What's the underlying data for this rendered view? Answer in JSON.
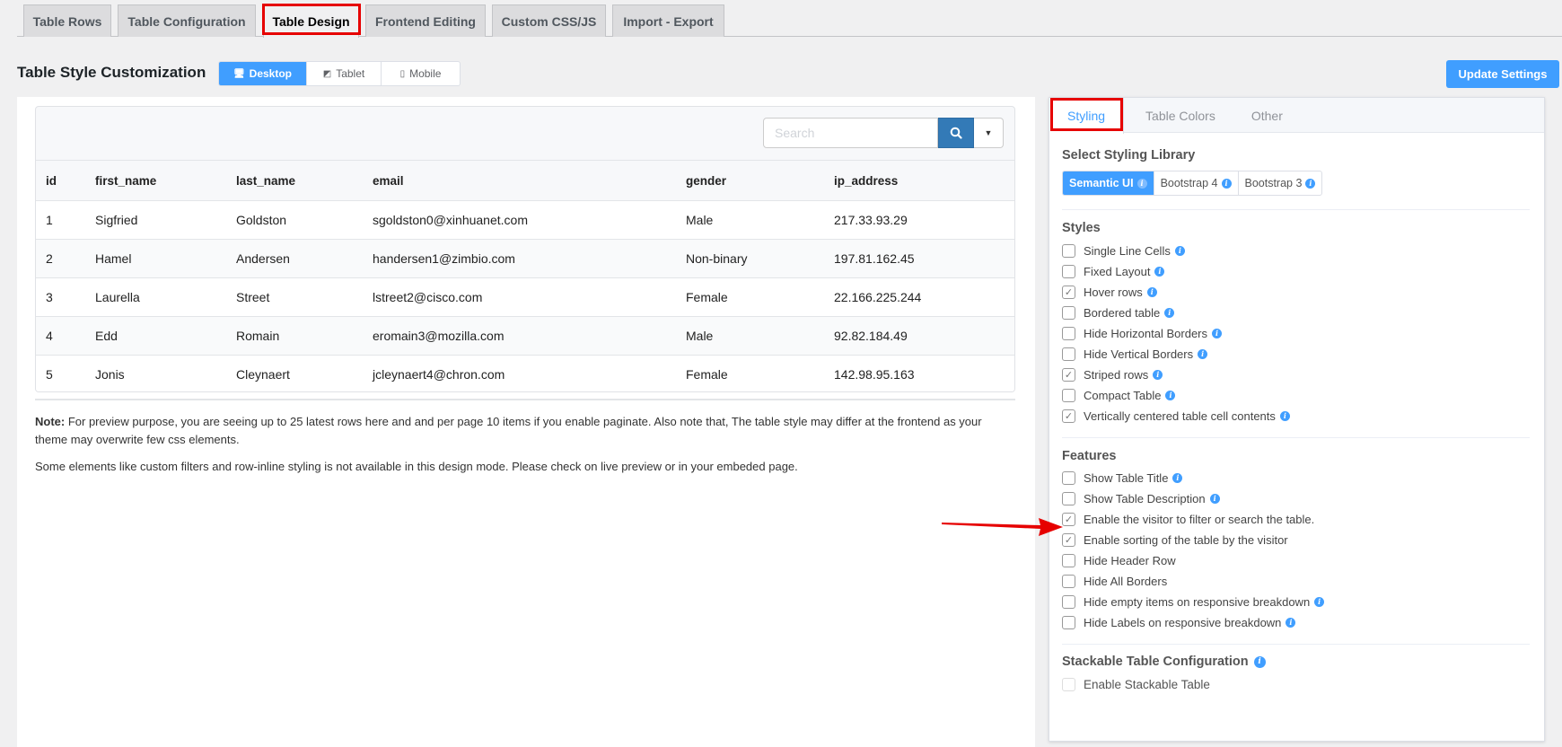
{
  "top_tabs": [
    {
      "label": "Table Rows",
      "active": false
    },
    {
      "label": "Table Configuration",
      "active": false
    },
    {
      "label": "Table Design",
      "active": true
    },
    {
      "label": "Frontend Editing",
      "active": false
    },
    {
      "label": "Custom CSS/JS",
      "active": false
    },
    {
      "label": "Import - Export",
      "active": false
    }
  ],
  "header": {
    "title": "Table Style Customization",
    "devices": [
      {
        "label": "Desktop",
        "icon": "desktop-icon",
        "active": true
      },
      {
        "label": "Tablet",
        "icon": "tablet-icon",
        "active": false
      },
      {
        "label": "Mobile",
        "icon": "mobile-icon",
        "active": false
      }
    ],
    "update_button": "Update Settings"
  },
  "preview": {
    "search_placeholder": "Search",
    "columns": [
      "id",
      "first_name",
      "last_name",
      "email",
      "gender",
      "ip_address"
    ],
    "rows": [
      [
        "1",
        "Sigfried",
        "Goldston",
        "sgoldston0@xinhuanet.com",
        "Male",
        "217.33.93.29"
      ],
      [
        "2",
        "Hamel",
        "Andersen",
        "handersen1@zimbio.com",
        "Non-binary",
        "197.81.162.45"
      ],
      [
        "3",
        "Laurella",
        "Street",
        "lstreet2@cisco.com",
        "Female",
        "22.166.225.244"
      ],
      [
        "4",
        "Edd",
        "Romain",
        "eromain3@mozilla.com",
        "Male",
        "92.82.184.49"
      ],
      [
        "5",
        "Jonis",
        "Cleynaert",
        "jcleynaert4@chron.com",
        "Female",
        "142.98.95.163"
      ]
    ],
    "note_label": "Note:",
    "note_text": " For preview purpose, you are seeing up to 25 latest rows here and and per page 10 items if you enable paginate. Also note that, The table style may differ at the frontend as your theme may overwrite few css elements.",
    "note2": "Some elements like custom filters and row-inline styling is not available in this design mode. Please check on live preview or in your embeded page."
  },
  "settings": {
    "tabs": [
      {
        "label": "Styling",
        "active": true
      },
      {
        "label": "Table Colors",
        "active": false
      },
      {
        "label": "Other",
        "active": false
      }
    ],
    "library_title": "Select Styling Library",
    "libraries": [
      {
        "label": "Semantic UI",
        "active": true
      },
      {
        "label": "Bootstrap 4",
        "active": false
      },
      {
        "label": "Bootstrap 3",
        "active": false
      }
    ],
    "styles_title": "Styles",
    "styles": [
      {
        "label": "Single Line Cells",
        "checked": false,
        "info": true
      },
      {
        "label": "Fixed Layout",
        "checked": false,
        "info": true
      },
      {
        "label": "Hover rows",
        "checked": true,
        "info": true
      },
      {
        "label": "Bordered table",
        "checked": false,
        "info": true
      },
      {
        "label": "Hide Horizontal Borders",
        "checked": false,
        "info": true
      },
      {
        "label": "Hide Vertical Borders",
        "checked": false,
        "info": true
      },
      {
        "label": "Striped rows",
        "checked": true,
        "info": true
      },
      {
        "label": "Compact Table",
        "checked": false,
        "info": true
      },
      {
        "label": "Vertically centered table cell contents",
        "checked": true,
        "info": true
      }
    ],
    "features_title": "Features",
    "features": [
      {
        "label": "Show Table Title",
        "checked": false,
        "info": true
      },
      {
        "label": "Show Table Description",
        "checked": false,
        "info": true
      },
      {
        "label": "Enable the visitor to filter or search the table.",
        "checked": true,
        "info": false
      },
      {
        "label": "Enable sorting of the table by the visitor",
        "checked": true,
        "info": false
      },
      {
        "label": "Hide Header Row",
        "checked": false,
        "info": false
      },
      {
        "label": "Hide All Borders",
        "checked": false,
        "info": false
      },
      {
        "label": "Hide empty items on responsive breakdown",
        "checked": false,
        "info": true
      },
      {
        "label": "Hide Labels on responsive breakdown",
        "checked": false,
        "info": true
      }
    ],
    "stackable_title": "Stackable Table Configuration",
    "stackable_option": {
      "label": "Enable Stackable Table",
      "checked": false
    }
  },
  "colors": {
    "accent": "#409eff",
    "search_button": "#337ab7",
    "annotation": "#e60000"
  }
}
